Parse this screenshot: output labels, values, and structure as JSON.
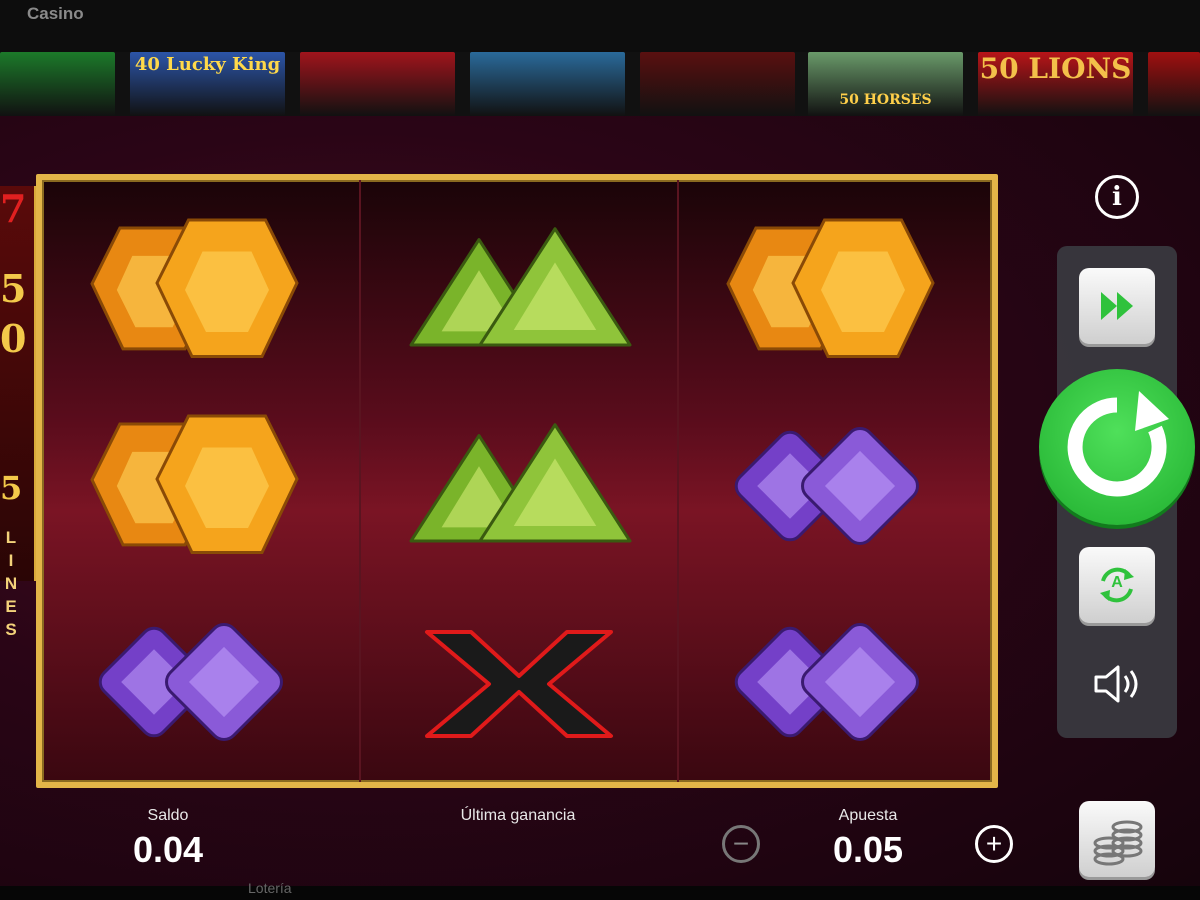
{
  "site": {
    "brand": "Casino"
  },
  "thumbnails": [
    {
      "label": "",
      "bg": "#1c7a2a"
    },
    {
      "label": "40 Lucky King",
      "bg": "#2c55a8"
    },
    {
      "label": "",
      "bg": "#a0141c"
    },
    {
      "label": "",
      "bg": "#2a6a9a"
    },
    {
      "label": "",
      "bg": "#5a1010"
    },
    {
      "label": "50 HORSES",
      "bg": "#6a9a6a"
    },
    {
      "label": "50 LIONS",
      "bg": "#b81418"
    },
    {
      "label": "",
      "bg": "#a01010"
    }
  ],
  "banner": {
    "digit_top": "7",
    "digit_mid": "5",
    "digit_bot": "0",
    "lines_num": "5",
    "lines_word": [
      "L",
      "I",
      "N",
      "E",
      "S"
    ]
  },
  "reels": [
    [
      "orange-gem",
      "orange-gem",
      "purple-gem"
    ],
    [
      "green-gem",
      "green-gem",
      "red-x"
    ],
    [
      "orange-gem",
      "purple-gem",
      "purple-gem"
    ]
  ],
  "controls": {
    "info": "i",
    "speed": "fast-forward-icon",
    "spin": "spin-icon",
    "auto": "A",
    "sound": "speaker-icon"
  },
  "balance": {
    "label": "Saldo",
    "value": "0.04"
  },
  "last_win": {
    "label": "Última ganancia",
    "value": ""
  },
  "bet": {
    "label": "Apuesta",
    "value": "0.05",
    "minus": "−",
    "plus": "+"
  },
  "footer": {
    "link": "Lotería"
  },
  "colors": {
    "frame": "#e3b548",
    "spin": "#2fc23c",
    "orange": "#f5a41c",
    "green": "#8fc43a",
    "purple": "#8a5ad8"
  }
}
